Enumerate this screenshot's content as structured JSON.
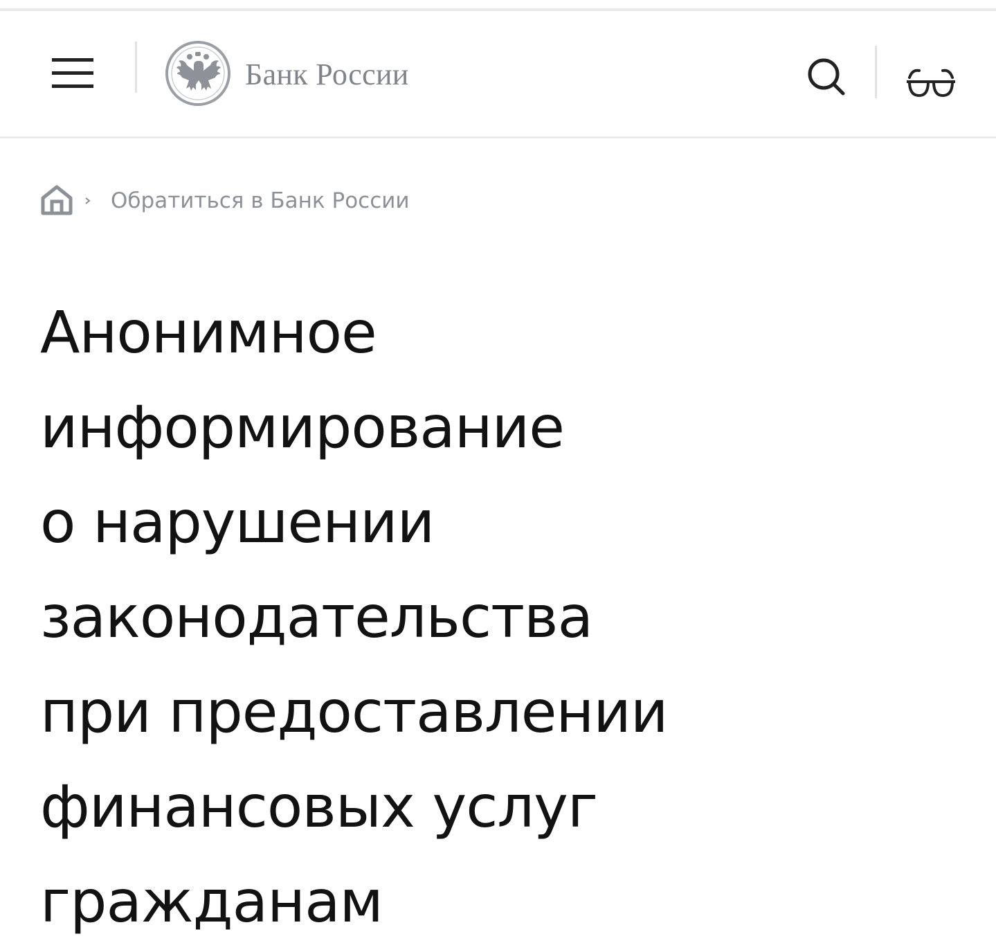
{
  "header": {
    "logo_text": "Банк России",
    "icons": {
      "menu": "hamburger-menu-icon",
      "emblem": "double-headed-eagle-emblem",
      "search": "search-icon",
      "accessibility": "glasses-icon"
    }
  },
  "breadcrumb": {
    "home_icon": "home-icon",
    "items": [
      "Обратиться в Банк России"
    ]
  },
  "page": {
    "title_lines": [
      "Анонимное",
      "информирование",
      "о нарушении",
      "законодательства",
      "при предоставлении",
      "финансовых услуг",
      "гражданам"
    ]
  },
  "colors": {
    "text": "#121212",
    "muted": "#8c9097",
    "logo": "#7f848b",
    "divider": "#e2e2e5"
  }
}
